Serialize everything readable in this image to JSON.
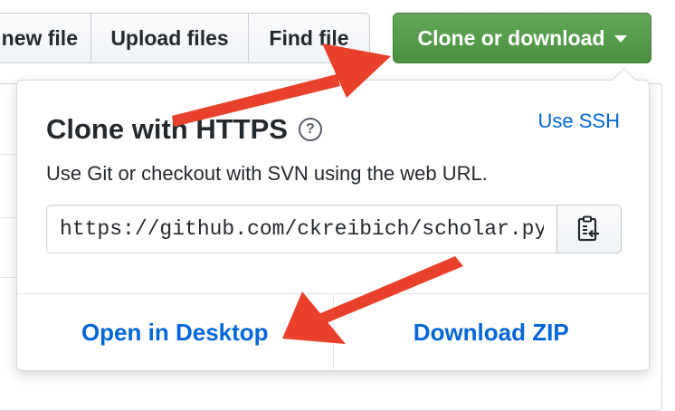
{
  "toolbar": {
    "new_file_label": "new file",
    "upload_files_label": "Upload files",
    "find_file_label": "Find file",
    "clone_label": "Clone or download"
  },
  "clone_panel": {
    "title": "Clone with HTTPS",
    "help_icon": "?",
    "use_ssh_label": "Use SSH",
    "description": "Use Git or checkout with SVN using the web URL.",
    "url_value": "https://github.com/ckreibich/scholar.py.git",
    "copy_icon": "clipboard-icon",
    "open_desktop_label": "Open in Desktop",
    "download_zip_label": "Download ZIP"
  },
  "colors": {
    "clone_button": "#5aa04f",
    "link": "#0366d6",
    "annotation_arrow": "#e8402a"
  }
}
